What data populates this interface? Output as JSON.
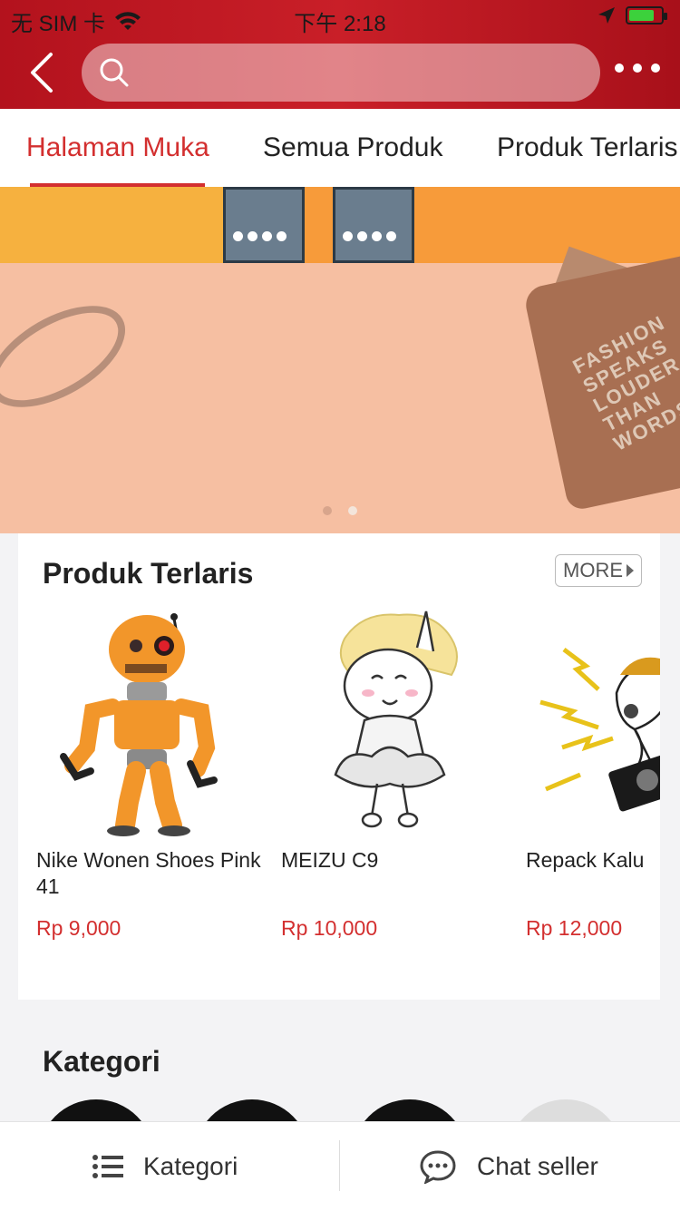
{
  "status_bar": {
    "carrier": "无 SIM 卡",
    "time": "下午 2:18"
  },
  "header": {
    "search_placeholder": ""
  },
  "tabs": [
    {
      "label": "Halaman Muka",
      "active": true
    },
    {
      "label": "Semua Produk",
      "active": false
    },
    {
      "label": "Produk Terlaris",
      "active": false
    }
  ],
  "banner": {
    "bag_text": "FASHION SPEAKS LOUDER THAN WORDS",
    "page_count": 2,
    "current_page": 2
  },
  "bestsellers": {
    "title": "Produk Terlaris",
    "more_label": "MORE",
    "items": [
      {
        "name": "Nike Wonen Shoes Pink 41",
        "price": "Rp 9,000",
        "image": "orange-robot-toy"
      },
      {
        "name": "MEIZU C9",
        "price": "Rp 10,000",
        "image": "unicorn-marilyn-sticker"
      },
      {
        "name": "Repack Kalu",
        "price": "Rp 12,000",
        "image": "unicorn-dj-sticker"
      }
    ]
  },
  "categories": {
    "title": "Kategori"
  },
  "bottom_bar": {
    "kategori_label": "Kategori",
    "chat_label": "Chat seller"
  },
  "colors": {
    "brand_red": "#c91f28",
    "accent_red": "#d32f2f"
  }
}
